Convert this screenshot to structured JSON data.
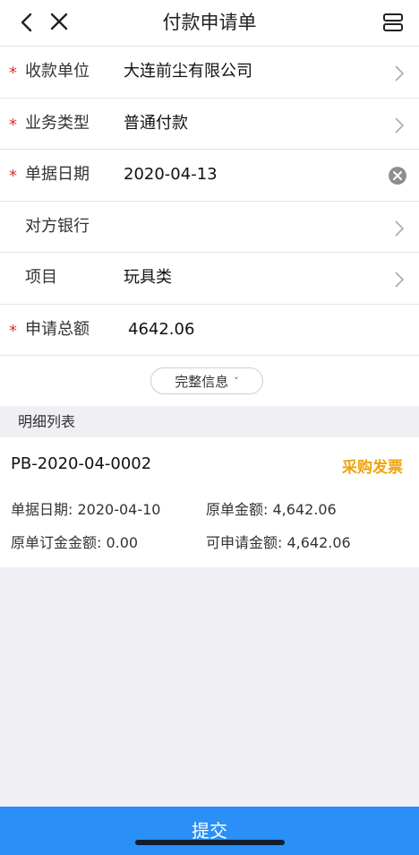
{
  "nav": {
    "title": "付款申请单",
    "back_icon": "chevron-left-icon",
    "close_icon": "close-icon",
    "more_icon": "expand-icon"
  },
  "form": {
    "required_mark": "*",
    "rows": [
      {
        "label": "收款单位",
        "value": "大连前尘有限公司",
        "required": true,
        "action": "chevron-right-icon"
      },
      {
        "label": "业务类型",
        "value": "普通付款",
        "required": true,
        "action": "chevron-right-icon"
      },
      {
        "label": "单据日期",
        "value": "2020-04-13",
        "required": true,
        "action": "clear-icon"
      },
      {
        "label": "对方银行",
        "value": "",
        "required": false,
        "action": "chevron-right-icon"
      },
      {
        "label": "项目",
        "value": "玩具类",
        "required": false,
        "action": "chevron-right-icon"
      },
      {
        "label": "申请总额",
        "value": "4642.06",
        "required": true,
        "action": ""
      }
    ],
    "more_info_label": "完整信息",
    "more_info_caret": "˅"
  },
  "detail": {
    "header": "明细列表",
    "items": [
      {
        "code": "PB-2020-04-0002",
        "tag": "采购发票",
        "date_label": "单据日期: 2020-04-10",
        "amount_label": "原单金额: 4,642.06",
        "deposit_label": "原单订金金额: 0.00",
        "available_label": "可申请金额: 4,642.06"
      }
    ]
  },
  "footer": {
    "submit_label": "提交"
  },
  "colors": {
    "accent": "#2a8ff7",
    "required": "#e0312f",
    "tag": "#f0a30a",
    "background": "#efeff4"
  }
}
